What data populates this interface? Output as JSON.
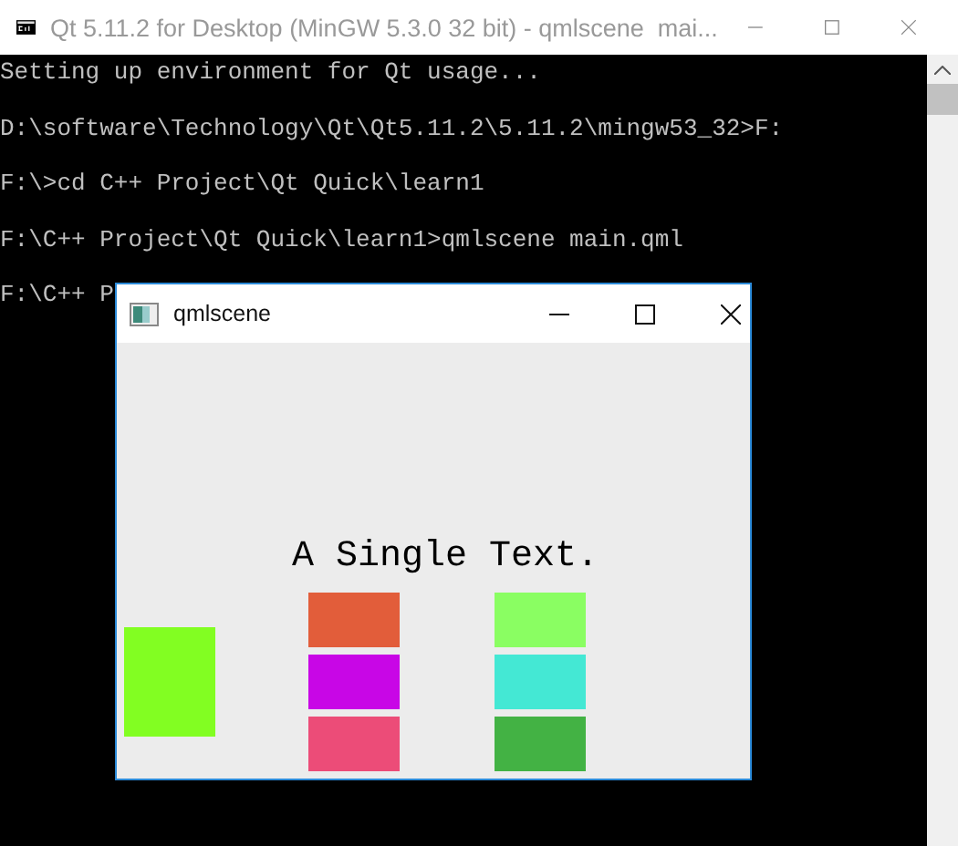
{
  "console_window": {
    "title": "Qt 5.11.2 for Desktop (MinGW 5.3.0 32 bit) - qmlscene  mai...",
    "lines": [
      "Setting up environment for Qt usage...",
      "D:\\software\\Technology\\Qt\\Qt5.11.2\\5.11.2\\mingw53_32>F:",
      "F:\\>cd C++ Project\\Qt Quick\\learn1",
      "F:\\C++ Project\\Qt Quick\\learn1>qmlscene main.qml",
      "F:\\C++ P"
    ]
  },
  "qml_window": {
    "title": "qmlscene",
    "text": "A Single Text.",
    "left_rect": {
      "color": "#82fe22"
    },
    "columns": [
      {
        "rects": [
          {
            "color": "#e25d3a"
          },
          {
            "color": "#c806e6"
          },
          {
            "color": "#ec4c78"
          }
        ]
      },
      {
        "rects": [
          {
            "color": "#8afe62"
          },
          {
            "color": "#44e8d4"
          },
          {
            "color": "#43b244"
          }
        ]
      }
    ]
  }
}
